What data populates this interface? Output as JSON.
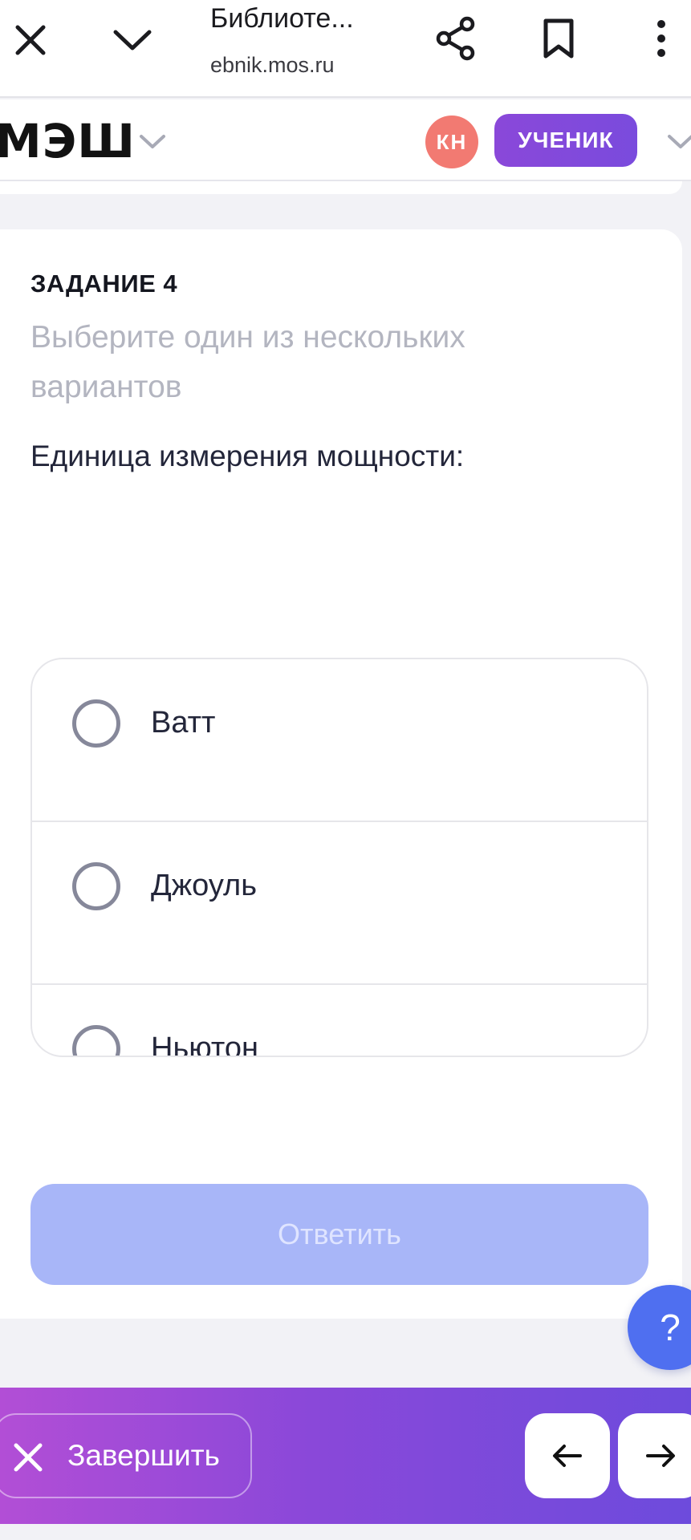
{
  "browser": {
    "title": "Библиоте...",
    "url": "ebnik.mos.ru",
    "icons": [
      "close-icon",
      "chevron-down-icon",
      "share-icon",
      "bookmark-icon",
      "more-vertical-icon"
    ]
  },
  "header": {
    "logo": "МЭШ",
    "avatar_initials": "КН",
    "role_label": "УЧЕНИК",
    "colors": {
      "avatar": "#f27a72",
      "role": "#8a48d9"
    }
  },
  "task": {
    "label": "ЗАДАНИЕ 4",
    "hint": "Выберите один из нескольких вариантов",
    "question": "Единица измерения мощности:",
    "options": [
      {
        "label": "Ватт",
        "selected": false
      },
      {
        "label": "Джоуль",
        "selected": false
      },
      {
        "label": "Ньютон",
        "selected": false
      }
    ],
    "answer_label": "Ответить",
    "answer_color": "#a8b6f8"
  },
  "help": {
    "label": "?"
  },
  "footer": {
    "finish_label": "Завершить",
    "prev_icon": "arrow-left-icon",
    "next_icon": "arrow-right-icon"
  }
}
